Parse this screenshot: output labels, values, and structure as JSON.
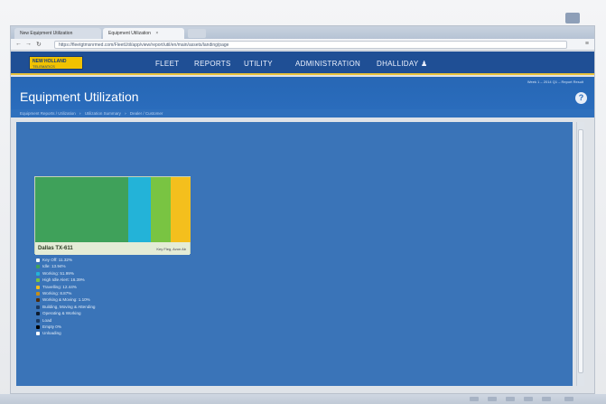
{
  "browser": {
    "tabs": [
      {
        "label": "New Equipment Utilization",
        "active": false
      },
      {
        "label": "Equipment Utilization",
        "active": true
      }
    ],
    "url": "https://fleetgtmsnrmed.com/FleetUtil/app/view/report/util/en/main/assets/landing/page"
  },
  "nav": {
    "logo_line1": "NEW HOLLAND",
    "logo_line2": "TELEMATICS",
    "items": [
      "FLEET",
      "REPORTS",
      "UTILITY",
      "ADMINISTRATION"
    ],
    "user": "DHALLIDAY"
  },
  "page": {
    "title": "Equipment Utilization",
    "top_info": "Week 1 – 2014 Q1 – Report Result",
    "breadcrumb": [
      "Equipment Reports / Utilization",
      "Utilization Summary",
      "Dealer / Customer"
    ]
  },
  "treemap": {
    "title": "Dallas TX-611",
    "subtitle": "Key Fleg, Avon Ab",
    "colors": {
      "idle_green": "#3fa15a",
      "work_cyan": "#23b3d8",
      "travel_lime": "#79c442",
      "standby_yellow": "#f4bf1d"
    }
  },
  "legend": [
    {
      "label": "Key Off: 11.32%",
      "color": "#ffffff"
    },
    {
      "label": "Idle: 13.94%",
      "color": "#3fa15a"
    },
    {
      "label": "Working: 51.99%",
      "color": "#23b3d8"
    },
    {
      "label": "High Idle Alert: 16.39%",
      "color": "#79c442"
    },
    {
      "label": "Travelling: 12.44%",
      "color": "#f4bf1d"
    },
    {
      "label": "Working: 8.87%",
      "color": "#c78e16"
    },
    {
      "label": "Working & Moving: 1.10%",
      "color": "#4e2c0c"
    },
    {
      "label": "Building, Moving & Attending",
      "color": "#1c3a60"
    },
    {
      "label": "Operating & Working",
      "color": "#0d1b2e"
    },
    {
      "label": "Load",
      "color": "#1c3a60"
    },
    {
      "label": "Empty 0%",
      "color": "#000000"
    },
    {
      "label": "Unloading",
      "color": "#ffffff"
    }
  ]
}
